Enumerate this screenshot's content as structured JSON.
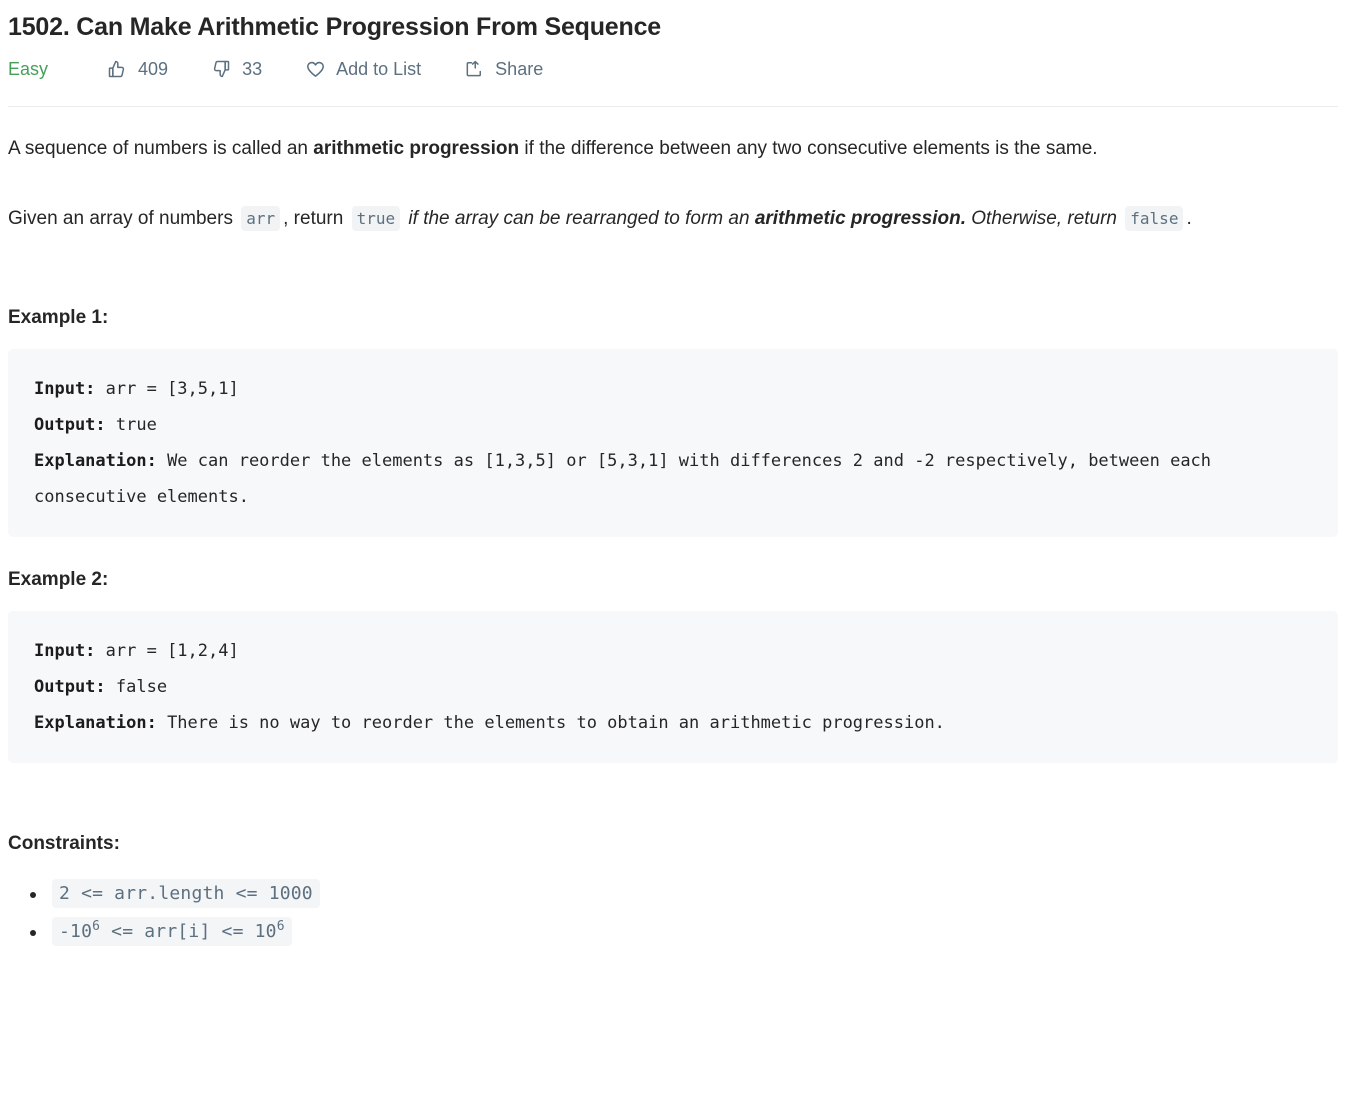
{
  "problem": {
    "title": "1502. Can Make Arithmetic Progression From Sequence",
    "difficulty": "Easy",
    "difficulty_color": "#46a05a"
  },
  "actions": {
    "likes": "409",
    "dislikes": "33",
    "add_to_list": "Add to List",
    "share": "Share",
    "icons": {
      "like": "thumbs-up-icon",
      "dislike": "thumbs-down-icon",
      "favorite": "heart-icon",
      "share": "share-icon"
    }
  },
  "description": {
    "p1": {
      "before": "A sequence of numbers is called an ",
      "bold": "arithmetic progression",
      "after": " if the difference between any two consecutive elements is the same."
    },
    "p2": {
      "s1": "Given an array of numbers ",
      "code1": "arr",
      "s2": ", return ",
      "code2": "true",
      "s3": " if the array can be rearranged to form an ",
      "bolditalic": "arithmetic progression.",
      "s4": " Otherwise, return ",
      "code3": "false",
      "s5": "."
    }
  },
  "examples": [
    {
      "heading": "Example 1:",
      "input_label": "Input:",
      "input_value": " arr = [3,5,1]",
      "output_label": "Output:",
      "output_value": " true",
      "explanation_label": "Explanation:",
      "explanation_value": " We can reorder the elements as [1,3,5] or [5,3,1] with differences 2 and -2 respectively, between each consecutive elements."
    },
    {
      "heading": "Example 2:",
      "input_label": "Input:",
      "input_value": " arr = [1,2,4]",
      "output_label": "Output:",
      "output_value": " false",
      "explanation_label": "Explanation:",
      "explanation_value": " There is no way to reorder the elements to obtain an arithmetic progression."
    }
  ],
  "constraints": {
    "heading": "Constraints:",
    "items": [
      {
        "pre": "2 <= arr.length <= 1000",
        "sup": "",
        "post": ""
      },
      {
        "pre": "-10",
        "sup": "6",
        "mid": " <= arr[i] <= 10",
        "sup2": "6",
        "post": ""
      }
    ]
  }
}
